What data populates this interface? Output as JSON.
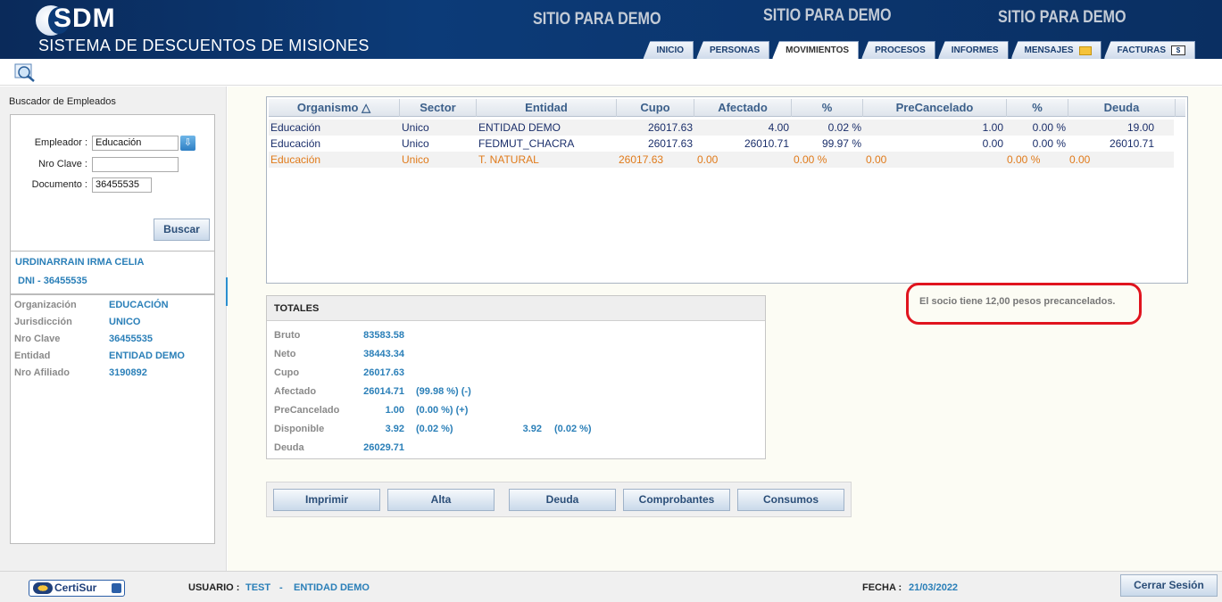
{
  "header": {
    "logo": "SDM",
    "system_title": "SISTEMA DE DESCUENTOS DE MISIONES",
    "demo_labels": [
      "SITIO PARA DEMO",
      "SITIO PARA DEMO",
      "SITIO PARA DEMO"
    ],
    "tabs": [
      "INICIO",
      "PERSONAS",
      "MOVIMIENTOS",
      "PROCESOS",
      "INFORMES",
      "MENSAJES",
      "FACTURAS"
    ],
    "active_tab": "MOVIMIENTOS",
    "facturas_icon_text": "$"
  },
  "search": {
    "title": "Buscador de Empleados",
    "empleador_label": "Empleador :",
    "empleador_value": "Educación",
    "nro_clave_label": "Nro Clave :",
    "nro_clave_value": "",
    "documento_label": "Documento :",
    "documento_value": "36455535",
    "buscar_label": "Buscar"
  },
  "employee": {
    "name": "URDINARRAIN IRMA CELIA",
    "dni": "DNI  -  36455535",
    "details": [
      {
        "label": "Organización",
        "value": "EDUCACIÓN"
      },
      {
        "label": "Jurisdicción",
        "value": "UNICO"
      },
      {
        "label": "Nro Clave",
        "value": "36455535"
      },
      {
        "label": "Entidad",
        "value": "ENTIDAD DEMO"
      },
      {
        "label": "Nro Afiliado",
        "value": "3190892"
      }
    ]
  },
  "grid": {
    "columns": [
      "Organismo",
      "Sector",
      "Entidad",
      "Cupo",
      "Afectado",
      "%",
      "PreCancelado",
      "%",
      "Deuda"
    ],
    "sort_indicator": "△",
    "rows": [
      [
        "Educación",
        "Unico",
        "ENTIDAD DEMO",
        "26017.63",
        "4.00",
        "0.02 %",
        "1.00",
        "0.00 %",
        "19.00"
      ],
      [
        "Educación",
        "Unico",
        "FEDMUT_CHACRA",
        "26017.63",
        "26010.71",
        "99.97 %",
        "0.00",
        "0.00 %",
        "26010.71"
      ],
      [
        "Educación",
        "Unico",
        "T. NATURAL",
        "26017.63",
        "0.00",
        "0.00 %",
        "0.00",
        "0.00 %",
        "0.00"
      ]
    ]
  },
  "notice": "El socio tiene 12,00 pesos precancelados.",
  "totals": {
    "title": "TOTALES",
    "bruto_label": "Bruto",
    "bruto": "83583.58",
    "neto_label": "Neto",
    "neto": "38443.34",
    "cupo_label": "Cupo",
    "cupo": "26017.63",
    "afectado_label": "Afectado",
    "afectado": "26014.71",
    "afectado_extra": "(99.98 %) (-)",
    "precancelado_label": "PreCancelado",
    "precancelado": "1.00",
    "precancelado_extra": "(0.00 %) (+)",
    "disponible_label": "Disponible",
    "disponible": "3.92",
    "disponible_extra": "(0.02 %)",
    "disponible2": "3.92",
    "disponible2_extra": "(0.02 %)",
    "deuda_label": "Deuda",
    "deuda": "26029.71"
  },
  "actions": [
    "Imprimir",
    "Alta",
    "Deuda",
    "Comprobantes",
    "Consumos"
  ],
  "footer": {
    "certisur": "CertiSur",
    "usuario_label": "USUARIO :",
    "usuario": "TEST",
    "separator": "-",
    "entidad": "ENTIDAD DEMO",
    "fecha_label": "FECHA :",
    "fecha": "21/03/2022",
    "logout": "Cerrar Sesión"
  },
  "colors": {
    "accent": "#2a7fb8",
    "header": "#0c3b78",
    "orange": "#e07a1a",
    "notice_border": "#e0141e"
  }
}
